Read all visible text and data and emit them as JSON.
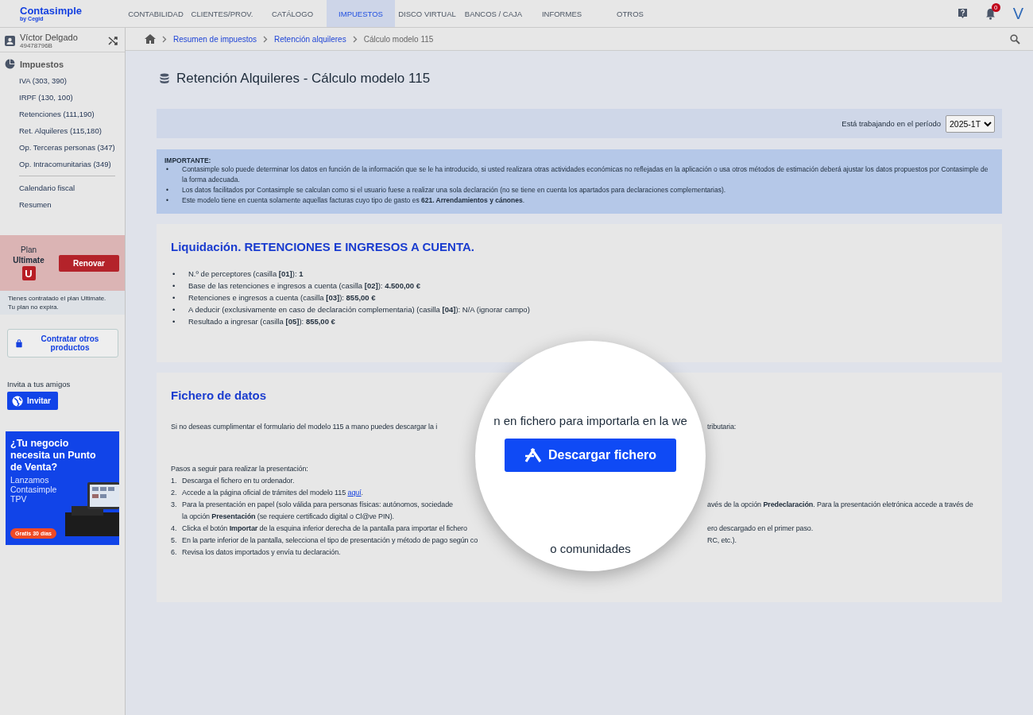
{
  "header": {
    "logo": "Contasimple",
    "logo_sub": "by Cegid",
    "nav": [
      {
        "label": "CONTABILIDAD",
        "selected": false
      },
      {
        "label": "CLIENTES/PROV.",
        "selected": false
      },
      {
        "label": "CATÁLOGO",
        "selected": false
      },
      {
        "label": "IMPUESTOS",
        "selected": true
      },
      {
        "label": "DISCO VIRTUAL",
        "selected": false
      },
      {
        "label": "BANCOS / CAJA",
        "selected": false
      },
      {
        "label": "INFORMES",
        "selected": false
      },
      {
        "label": "OTROS",
        "selected": false
      }
    ],
    "notifications": "0",
    "avatar": "V"
  },
  "sidebar": {
    "user": {
      "name": "Víctor Delgado",
      "id": "49478796B"
    },
    "section": "Impuestos",
    "items": [
      "IVA (303, 390)",
      "IRPF (130, 100)",
      "Retenciones (111,190)",
      "Ret. Alquileres (115,180)",
      "Op. Terceras personas (347)",
      "Op. Intracomunitarias (349)"
    ],
    "extra_items": [
      "Calendario fiscal",
      "Resumen"
    ],
    "plan": {
      "label": "Plan",
      "name": "Ultimate",
      "badge": "U",
      "button": "Renovar",
      "note": [
        "Tienes contratado el plan Ultimate.",
        "Tu plan no expira."
      ]
    },
    "products_button": "Contratar otros productos",
    "invite": {
      "label": "Invita a tus amigos",
      "button": "Invitar"
    },
    "ad": {
      "headline": "¿Tu negocio necesita un Punto de Venta?",
      "text": "Lanzamos Contasimple TPV",
      "cta": "Gratis 30 días"
    }
  },
  "breadcrumb": [
    "Resumen de impuestos",
    "Retención alquileres",
    "Cálculo modelo 115"
  ],
  "title": "Retención Alquileres - Cálculo modelo 115",
  "period": {
    "label": "Está trabajando en el período",
    "value": "2025-1T"
  },
  "bullet": "•",
  "important": {
    "title": "IMPORTANTE:",
    "bullets": [
      "Contasimple solo puede determinar los datos en función de la información que se le ha introducido, si usted realizara otras actividades económicas no reflejadas en la aplicación o usa otros métodos de estimación deberá ajustar los datos propuestos por Contasimple de la forma adecuada.",
      "Los datos facilitados por Contasimple se calculan como si el usuario fuese a realizar una sola declaración (no se tiene en cuenta los apartados para declaraciones complementarias).",
      "Este modelo tiene en cuenta solamente aquellas facturas cuyo tipo de gasto es **621. Arrendamientos y cánones**."
    ]
  },
  "liquidacion": {
    "title": "Liquidación. RETENCIONES E INGRESOS A CUENTA.",
    "bullets": [
      "N.º de perceptores (casilla **[01]**): **1**",
      "Base de las retenciones e ingresos a cuenta (casilla **[02]**): **4.500,00 €**",
      "Retenciones e ingresos a cuenta (casilla **[03]**): **855,00 €**",
      "A deducir (exclusivamente en caso de declaración complementaria) (casilla **[04]**): N/A (ignorar campo)",
      "Resultado a ingresar (casilla **[05]**): **855,00 €**"
    ]
  },
  "fichero": {
    "title": "Fichero de datos",
    "intro": {
      "left": "Si no deseas cumplimentar el formulario del modelo 115 a mano puedes descargar la i",
      "right": "tributaria:"
    },
    "steps_title": "Pasos a seguir para realizar la presentación:",
    "steps": [
      {
        "number": "1.",
        "left": "Descarga el fichero en tu ordenador."
      },
      {
        "number": "2.",
        "left": "Accede a la página oficial de trámites del modelo 115",
        "link": "aquí",
        "after": "."
      },
      {
        "number": "3.",
        "left": "Para la presentación en papel (solo válida para personas físicas: autónomos, sociedade",
        "right": "avés de la opción **Predeclaración**. Para la presentación eletrónica accede a través de",
        "continuation": "la opción **Presentación** (se requiere certificado digital o Cl@ve PIN)."
      },
      {
        "number": "4.",
        "left": "Clicka el botón **Importar** de la esquina inferior derecha de la pantalla para importar el fichero",
        "right": "ero descargado en el primer paso."
      },
      {
        "number": "5.",
        "left": "En la parte inferior de la pantalla, selecciona el tipo de presentación y método de pago según co",
        "right": "RC, etc.)."
      },
      {
        "number": "6.",
        "left": "Revisa los datos importados y envía tu declaración."
      }
    ],
    "magnifier": {
      "top_text": "n en fichero para importarla en la we",
      "button": "Descargar fichero",
      "bottom_text": "o comunidades"
    }
  }
}
